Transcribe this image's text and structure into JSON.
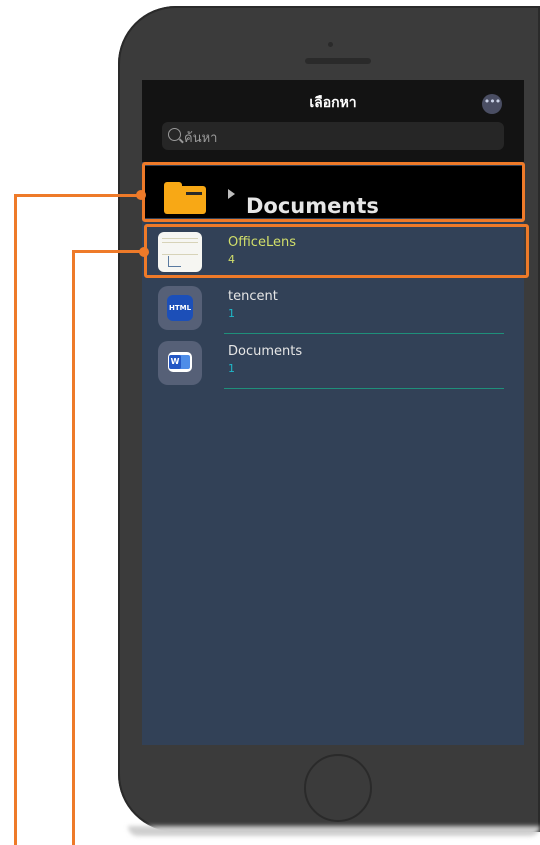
{
  "nav": {
    "title": "เลือกหา",
    "more_label": "•••",
    "search_placeholder": "ค้นหา"
  },
  "folder": {
    "title": "Documents"
  },
  "rows": [
    {
      "name": "OfficeLens",
      "count": "4"
    },
    {
      "name": "tencent",
      "count": "1",
      "badge": "HTML"
    },
    {
      "name": "Documents",
      "count": "1",
      "badge": "W"
    }
  ],
  "colors": {
    "callout": "#ee7a29",
    "highlight_text": "#d2df6a",
    "count_text": "#1fb8c8",
    "folder_icon": "#f8a815"
  }
}
